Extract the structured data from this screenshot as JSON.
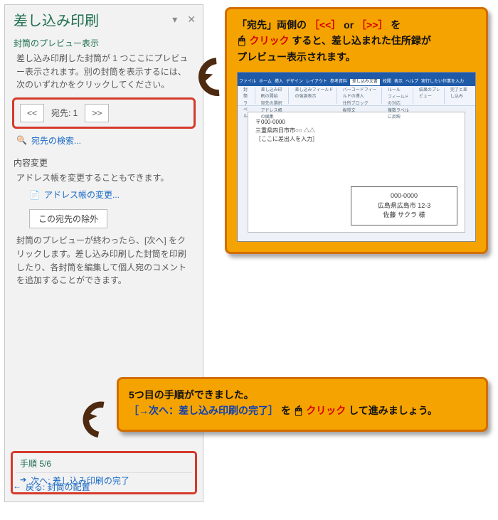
{
  "pane": {
    "title": "差し込み印刷",
    "section_preview_label": "封筒のプレビュー表示",
    "preview_body": "差し込み印刷した封筒が 1 つここにプレビュー表示されます。別の封筒を表示するには、次のいずれかをクリックしてください。",
    "nav": {
      "prev": "<<",
      "label": "宛先: 1",
      "next": ">>"
    },
    "search_link": "宛先の検索...",
    "section_change_label": "内容変更",
    "change_body": "アドレス帳を変更することもできます。",
    "change_link": "アドレス帳の変更...",
    "exclude_btn": "この宛先の除外",
    "after_body": "封筒のプレビューが終わったら、[次へ] をクリックします。差し込み印刷した封筒を印刷したり、各封筒を編集して個人宛のコメントを追加することができます。",
    "step_label": "手順 5/6",
    "next_link": "次へ: 差し込み印刷の完了",
    "back_link": "戻る: 封筒の配置"
  },
  "callout1": {
    "line1a": "「宛先」両側の ",
    "prev_sym": "［<<］",
    "or": " or ",
    "next_sym": "［>>］",
    "line1b": " を",
    "click_word": "クリック",
    "line2a": "すると、差し込まれた住所録が",
    "line3": "プレビュー表示されます。",
    "preview": {
      "tabs": [
        "ファイル",
        "ホーム",
        "挿入",
        "デザイン",
        "レイアウト",
        "参考資料",
        "差し込み文書",
        "校閲",
        "表示",
        "ヘルプ",
        "実行したい作業を入力"
      ],
      "tool_groups": [
        [
          "封筒",
          "ラベル"
        ],
        [
          "差し込み印刷の開始",
          "宛先の選択",
          "アドレス帳の編集"
        ],
        [
          "差し込みフィールドの強調表示"
        ],
        [
          "バーコードフィールドの挿入",
          "住所ブロック",
          "挨拶文"
        ],
        [
          "ルール",
          "フィールドの対応",
          "複数ラベルに反映"
        ],
        [
          "結果のプレビュー"
        ],
        [
          "完了と差し込み"
        ]
      ],
      "sender_post": "〒000-0000",
      "sender_addr": "三重県四日市市○○ △△",
      "sender_name": "［ここに差出人を入力］",
      "addr_post": "000-0000",
      "addr_line": "広島県広島市 12-3",
      "addr_name": "佐藤 サクラ 様"
    }
  },
  "callout2": {
    "line1": "5つ目の手順ができました。",
    "link_text": "［→次へ：差し込み印刷の完了］",
    "tail_a": " を",
    "click_word": "クリック",
    "tail_b": "して進みましょう。"
  }
}
